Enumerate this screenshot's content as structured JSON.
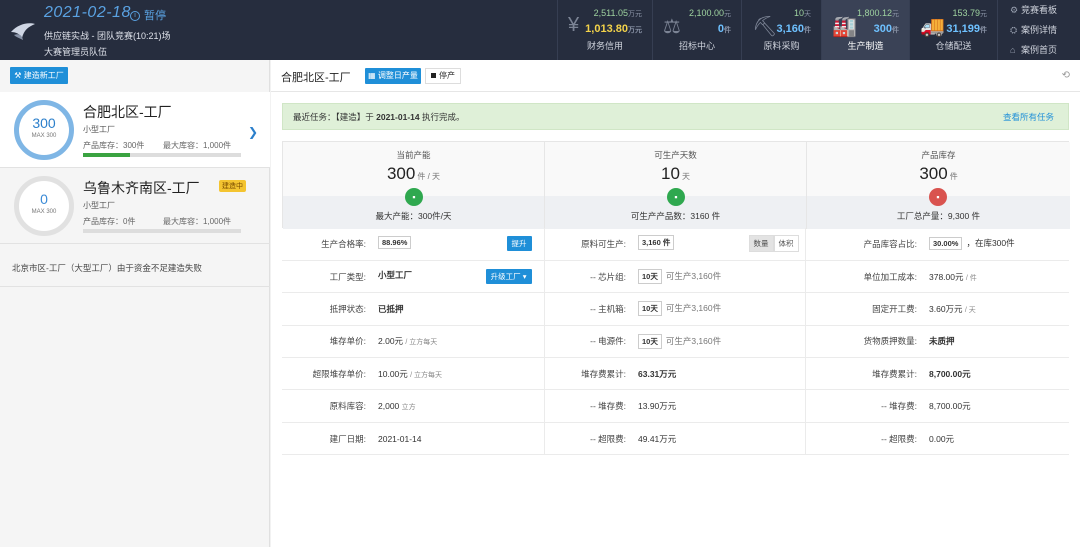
{
  "header": {
    "date": "2021-02-18",
    "status": "暂停",
    "status_icon": "i",
    "subtitle": "供应链实战 - 团队竞赛(10:21)场",
    "team": "大赛管理员队伍",
    "stats": [
      {
        "icon": "¥",
        "icon_name": "yuan-icon",
        "top": "2,511.05",
        "top_unit": "万元",
        "bottom": "1,013.80",
        "bottom_unit": "万元",
        "label": "财务信用"
      },
      {
        "icon": "⚖",
        "icon_name": "gavel-icon",
        "top": "2,100.00",
        "top_unit": "元",
        "bottom": "0",
        "bottom_unit": "件",
        "label": "招标中心"
      },
      {
        "icon": "⛏",
        "icon_name": "mine-cart-icon",
        "top": "10",
        "top_unit": "天",
        "bottom": "3,160",
        "bottom_unit": "件",
        "label": "原料采购"
      },
      {
        "icon": "🏭",
        "icon_name": "factory-icon",
        "top": "1,800.12",
        "top_unit": "元",
        "bottom": "300",
        "bottom_unit": "件",
        "label": "生产制造",
        "active": true
      },
      {
        "icon": "🚚",
        "icon_name": "truck-icon",
        "top": "153.79",
        "top_unit": "元",
        "bottom": "31,199",
        "bottom_unit": "件",
        "label": "仓储配送"
      }
    ],
    "menu": [
      {
        "icon": "⚙",
        "label": "竞赛看板"
      },
      {
        "icon": "⛭",
        "label": "案例详情"
      },
      {
        "icon": "⌂",
        "label": "案例首页"
      }
    ]
  },
  "sidebar": {
    "build_button": "建造新工厂",
    "factories": [
      {
        "capacity": "300",
        "max": "MAX 300",
        "name": "合肥北区-工厂",
        "type": "小型工厂",
        "inventory": "产品库存：300件",
        "max_storage": "最大库容：1,000件",
        "selected": true,
        "fill": 0.3
      },
      {
        "capacity": "0",
        "max": "MAX 300",
        "name": "乌鲁木齐南区-工厂",
        "type": "小型工厂",
        "inventory": "产品库存：0件",
        "max_storage": "最大库容：1,000件",
        "badge": "建造中",
        "fill": 0
      }
    ],
    "failed_note": "北京市区-工厂（大型工厂）由于资金不足建造失败"
  },
  "main": {
    "title": "合肥北区-工厂",
    "adjust_button": "调整日产量",
    "stop_button": "停产",
    "notice": {
      "prefix": "最近任务：【建造】于 ",
      "date": "2021-01-14",
      "suffix": " 执行完成。",
      "view_all": "查看所有任务"
    },
    "summary": [
      {
        "label": "当前产能",
        "value": "300",
        "unit": "件 / 天",
        "icon": "▪",
        "icon_color": "#2fa84f",
        "foot": "最大产能：300件/天"
      },
      {
        "label": "可生产天数",
        "value": "10",
        "unit": "天",
        "icon": "▪",
        "icon_color": "#2fa84f",
        "foot": "可生产产品数：3160 件"
      },
      {
        "label": "产品库存",
        "value": "300",
        "unit": "件",
        "icon": "▪",
        "icon_color": "#d9534f",
        "foot": "工厂总产量：9,300 件"
      }
    ],
    "rows": [
      [
        {
          "k": "生产合格率:",
          "v": "88.96%",
          "boxed": true,
          "btn": "提升"
        },
        {
          "k": "原料可生产:",
          "v": "3,160 件",
          "boxed": true,
          "seg": [
            "数量",
            "体积"
          ]
        },
        {
          "k": "产品库容占比:",
          "v": "30.00%",
          "boxed": true,
          "tail": "，在库300件"
        }
      ],
      [
        {
          "k": "工厂类型:",
          "v": "小型工厂",
          "bold": true,
          "btn": "升级工厂 ▾"
        },
        {
          "k": "-- 芯片组:",
          "v": "10天",
          "boxed": true,
          "tail": "可生产3,160件",
          "muted": true
        },
        {
          "k": "单位加工成本:",
          "v": "378.00元",
          "small": "/ 件"
        }
      ],
      [
        {
          "k": "抵押状态:",
          "v": "已抵押",
          "bold": true
        },
        {
          "k": "-- 主机箱:",
          "v": "10天",
          "boxed": true,
          "tail": "可生产3,160件",
          "muted": true
        },
        {
          "k": "固定开工费:",
          "v": "3.60万元",
          "small": "/ 天"
        }
      ],
      [
        {
          "k": "堆存单价:",
          "v": "2.00元",
          "small": "/ 立方每天"
        },
        {
          "k": "-- 电源件:",
          "v": "10天",
          "boxed": true,
          "tail": "可生产3,160件",
          "muted": true
        },
        {
          "k": "货物质押数量:",
          "v": "未质押",
          "bold": true
        }
      ],
      [
        {
          "k": "超限堆存单价:",
          "v": "10.00元",
          "small": "/ 立方每天"
        },
        {
          "k": "堆存费累计:",
          "v": "63.31万元",
          "bold": true
        },
        {
          "k": "堆存费累计:",
          "v": "8,700.00元",
          "bold": true
        }
      ],
      [
        {
          "k": "原料库容:",
          "v": "2,000",
          "small": "立方"
        },
        {
          "k": "-- 堆存费:",
          "v": "13.90万元"
        },
        {
          "k": "-- 堆存费:",
          "v": "8,700.00元"
        }
      ],
      [
        {
          "k": "建厂日期:",
          "v": "2021-01-14"
        },
        {
          "k": "-- 超限费:",
          "v": "49.41万元"
        },
        {
          "k": "-- 超限费:",
          "v": "0.00元"
        }
      ]
    ]
  }
}
